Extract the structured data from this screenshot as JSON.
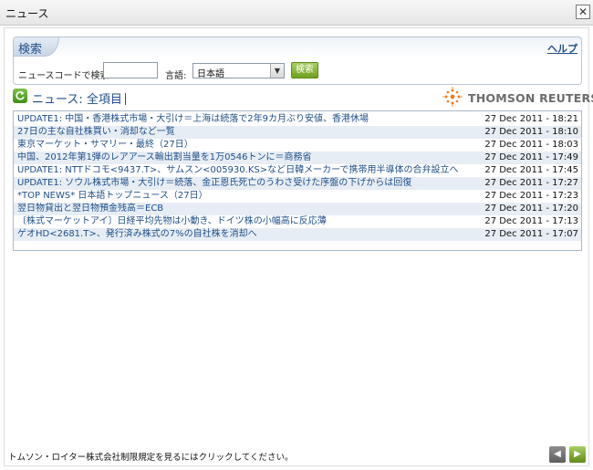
{
  "window": {
    "title": "ニュース",
    "close_glyph": "✕"
  },
  "search": {
    "tab_label": "検索",
    "help_label": "ヘルプ",
    "code_label": "ニュースコードで検索",
    "code_value": "",
    "language_label": "言語:",
    "language_value": "日本語",
    "search_button": "検索"
  },
  "news": {
    "header": "ニュース: 全項目",
    "brand": "THOMSON REUTERS",
    "rows": [
      {
        "headline": "UPDATE1: 中国・香港株式市場・大引け＝上海は続落で2年9カ月ぶり安値、香港休場",
        "time": "27 Dec 2011 - 18:21"
      },
      {
        "headline": "27日の主な自社株買い・消却など一覧",
        "time": "27 Dec 2011 - 18:10"
      },
      {
        "headline": "東京マーケット・サマリー・最終（27日）",
        "time": "27 Dec 2011 - 18:03"
      },
      {
        "headline": "中国、2012年第1弾のレアアース輸出割当量を1万0546トンに＝商務省",
        "time": "27 Dec 2011 - 17:49"
      },
      {
        "headline": "UPDATE1: NTTドコモ<9437.T>、サムスン<005930.KS>など日韓メーカーで携帯用半導体の合弁設立へ",
        "time": "27 Dec 2011 - 17:45"
      },
      {
        "headline": "UPDATE1: ソウル株式市場・大引け＝続落、金正恩氏死亡のうわさ受けた序盤の下げからは回復",
        "time": "27 Dec 2011 - 17:27"
      },
      {
        "headline": "*TOP NEWS* 日本語トップニュース（27日）",
        "time": "27 Dec 2011 - 17:23"
      },
      {
        "headline": "翌日物貸出と翌日物預金残高＝ECB",
        "time": "27 Dec 2011 - 17:20"
      },
      {
        "headline": "〔株式マーケットアイ〕日経平均先物は小動き、ドイツ株の小幅高に反応薄",
        "time": "27 Dec 2011 - 17:13"
      },
      {
        "headline": "ゲオHD<2681.T>、発行済み株式の7%の自社株を消却へ",
        "time": "27 Dec 2011 - 17:07"
      }
    ]
  },
  "footer": {
    "disclaimer": "トムソン・ロイター株式会社制限規定を見るにはクリックしてください。",
    "prev_glyph": "◀",
    "next_glyph": "▶"
  },
  "colors": {
    "accent_blue": "#1f4f8a",
    "button_green": "#6f9f1e",
    "row_alt": "#e7edf4",
    "brand_orange": "#f07d1c"
  },
  "icons": [
    "close-icon",
    "refresh-icon",
    "dropdown-arrow-icon",
    "prev-arrow-icon",
    "next-arrow-icon",
    "thomson-reuters-logo"
  ]
}
